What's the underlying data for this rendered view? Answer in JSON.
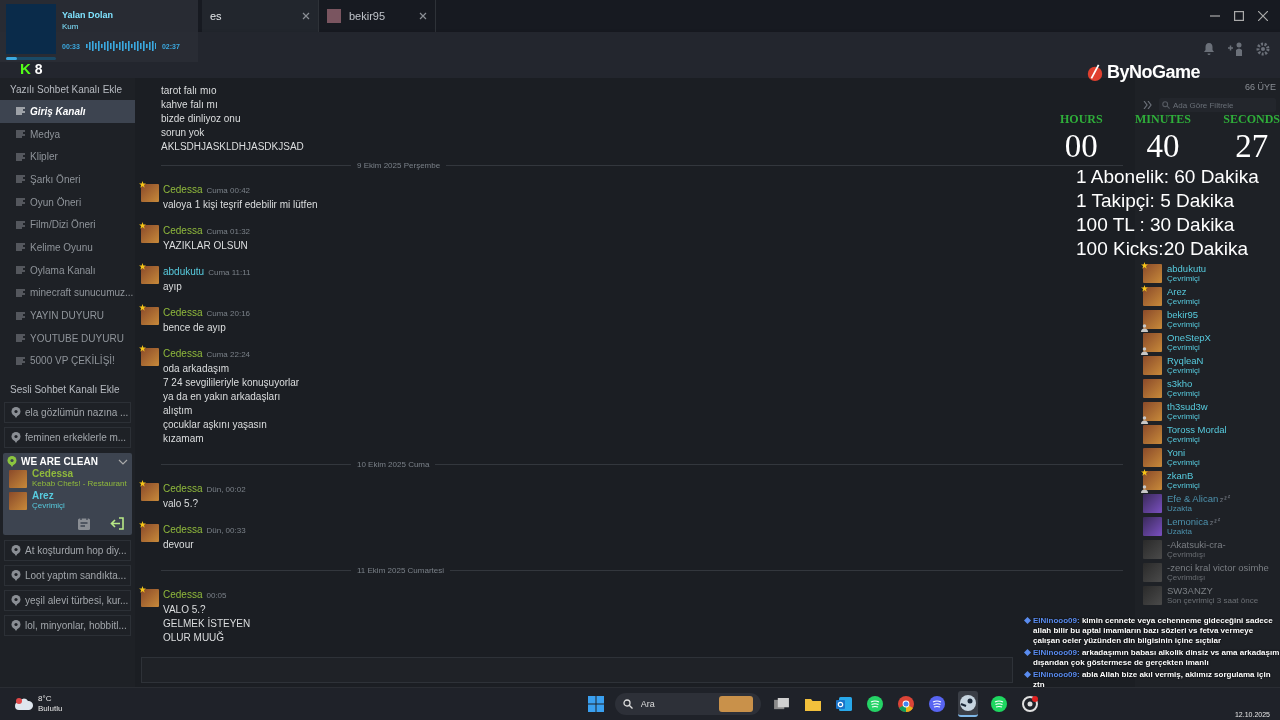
{
  "music_widget": {
    "title": "Yalan Dolan",
    "artist": "Kum",
    "elapsed": "00:33",
    "duration": "02:37",
    "level": 0.21
  },
  "tabs": [
    {
      "label": "es",
      "selected": true
    },
    {
      "label": "bekir95",
      "selected": false
    }
  ],
  "kick_badge": {
    "logo": "K",
    "count": "8"
  },
  "logo": "ByNoGame",
  "member_count": "66 ÜYE",
  "filter": {
    "placeholder": "Ada Göre Filtrele"
  },
  "sidebar": {
    "text_heading": "Yazılı Sohbet Kanalı Ekle",
    "text_channels": [
      {
        "name": "Giriş Kanalı",
        "selected": true
      },
      {
        "name": "Medya",
        "selected": false
      },
      {
        "name": "Klipler",
        "selected": false
      },
      {
        "name": "Şarkı Öneri",
        "selected": false
      },
      {
        "name": "Oyun Öneri",
        "selected": false
      },
      {
        "name": "Film/Dizi Öneri",
        "selected": false
      },
      {
        "name": "Kelime Oyunu",
        "selected": false
      },
      {
        "name": "Oylama Kanalı",
        "selected": false
      },
      {
        "name": "minecraft sunucumuz...",
        "selected": false
      },
      {
        "name": "YAYIN DUYURU",
        "selected": false
      },
      {
        "name": "YOUTUBE DUYURU",
        "selected": false
      },
      {
        "name": "5000 VP ÇEKİLİŞİ!",
        "selected": false
      }
    ],
    "voice_heading": "Sesli Sohbet Kanalı Ekle",
    "voice_channels": [
      {
        "name": "ela gözlümün nazına ...",
        "active": false
      },
      {
        "name": "feminen erkeklerle m...",
        "active": false
      },
      {
        "name": "WE ARE CLEAN",
        "active": true,
        "members": [
          {
            "name": "Cedessa",
            "status": "Kebab Chefs! - Restaurant",
            "kind": "ingame"
          },
          {
            "name": "Arez",
            "status": "Çevrimiçi",
            "kind": "online"
          }
        ]
      },
      {
        "name": "At koşturdum hop diy...",
        "active": false
      },
      {
        "name": "Loot yaptım sandıkta...",
        "active": false
      },
      {
        "name": "yeşil alevi türbesi, kur...",
        "active": false
      },
      {
        "name": "lol, minyonlar, hobbitl...",
        "active": false
      }
    ]
  },
  "chat": [
    {
      "kind": "continuation",
      "lines": [
        "tarot falı mıo",
        "kahve falı mı",
        "bizde dinliyoz onu",
        "sorun yok",
        "AKLSDHJASKLDHJASDKJSAD"
      ]
    },
    {
      "kind": "divider",
      "label": "9 Ekim 2025 Perşembe"
    },
    {
      "kind": "message",
      "author": {
        "name": "Cedessa",
        "kind": "ingame"
      },
      "time": "Cuma 00:42",
      "lines": [
        "valoya 1 kişi teşrif edebilir mi lütfen"
      ]
    },
    {
      "kind": "message",
      "author": {
        "name": "Cedessa",
        "kind": "ingame"
      },
      "time": "Cuma 01:32",
      "lines": [
        "YAZIKLAR OLSUN"
      ]
    },
    {
      "kind": "message",
      "author": {
        "name": "abdukutu",
        "kind": "online"
      },
      "time": "Cuma 11:11",
      "lines": [
        "ayıp"
      ]
    },
    {
      "kind": "message",
      "author": {
        "name": "Cedessa",
        "kind": "ingame"
      },
      "time": "Cuma 20:16",
      "lines": [
        "bence de ayıp"
      ]
    },
    {
      "kind": "message",
      "author": {
        "name": "Cedessa",
        "kind": "ingame"
      },
      "time": "Cuma 22:24",
      "lines": [
        "oda arkadaşım",
        "7 24 sevgilileriyle konuşuyorlar",
        "ya da en yakın arkadaşları",
        "alıştım",
        "çocuklar aşkını yaşasın",
        "kızamam"
      ]
    },
    {
      "kind": "divider",
      "label": "10 Ekim 2025 Cuma"
    },
    {
      "kind": "message",
      "author": {
        "name": "Cedessa",
        "kind": "ingame"
      },
      "time": "Dün, 00:02",
      "lines": [
        "valo 5.?"
      ]
    },
    {
      "kind": "message",
      "author": {
        "name": "Cedessa",
        "kind": "ingame"
      },
      "time": "Dün, 00:33",
      "lines": [
        "devour"
      ]
    },
    {
      "kind": "divider",
      "label": "11 Ekim 2025 Cumartesi"
    },
    {
      "kind": "message",
      "author": {
        "name": "Cedessa",
        "kind": "ingame"
      },
      "time": "00:05",
      "lines": [
        "VALO 5.?",
        "GELMEK İSTEYEN",
        "OLUR MUUĞ"
      ]
    }
  ],
  "members": [
    {
      "name": "abdukutu",
      "status": "Çevrimiçi",
      "kind": "online",
      "starred": true,
      "friend": false
    },
    {
      "name": "Arez",
      "status": "Çevrimiçi",
      "kind": "online",
      "starred": true,
      "friend": false
    },
    {
      "name": "bekir95",
      "status": "Çevrimiçi",
      "kind": "online",
      "starred": false,
      "friend": true
    },
    {
      "name": "OneStepX",
      "status": "Çevrimiçi",
      "kind": "online",
      "starred": false,
      "friend": true
    },
    {
      "name": "RyqleaN",
      "status": "Çevrimiçi",
      "kind": "online",
      "starred": false,
      "friend": false
    },
    {
      "name": "s3kho",
      "status": "Çevrimiçi",
      "kind": "online",
      "starred": false,
      "friend": false
    },
    {
      "name": "th3sud3w",
      "status": "Çevrimiçi",
      "kind": "online",
      "starred": false,
      "friend": true
    },
    {
      "name": "Toross Mordal",
      "status": "Çevrimiçi",
      "kind": "online",
      "starred": false,
      "friend": false
    },
    {
      "name": "Yoni",
      "status": "Çevrimiçi",
      "kind": "online",
      "starred": false,
      "friend": false
    },
    {
      "name": "zkanB",
      "status": "Çevrimiçi",
      "kind": "online",
      "starred": true,
      "friend": true
    },
    {
      "name": "Efe & Alican",
      "status": "Uzakta",
      "kind": "away",
      "starred": false,
      "friend": false
    },
    {
      "name": "Lemonica",
      "status": "Uzakta",
      "kind": "away",
      "starred": false,
      "friend": false
    },
    {
      "name": "-Akatsuki-cra-",
      "status": "Çevrimdışı",
      "kind": "offline",
      "starred": false,
      "friend": false
    },
    {
      "name": "-zenci kral victor osimhe",
      "status": "Çevrimdışı",
      "kind": "offline",
      "starred": false,
      "friend": false
    },
    {
      "name": "SW3ANZY",
      "status": "Son çevrimiçi 3 saat önce",
      "kind": "offline",
      "starred": false,
      "friend": false
    }
  ],
  "timer": {
    "units": [
      {
        "label": "HOURS",
        "value": "00"
      },
      {
        "label": "MINUTES",
        "value": "40"
      },
      {
        "label": "SECONDS",
        "value": "27"
      }
    ],
    "rules": [
      "1 Abonelik: 60 Dakika",
      "1 Takipçi: 5 Dakika",
      "100 TL : 30 Dakika",
      "100 Kicks:20 Dakika"
    ]
  },
  "stream_chat": [
    {
      "user": "ElNinooo09:",
      "text": "kimin cennete veya cehenneme gideceğini sadece allah bilir bu aptal imamların bazı sözleri vs fetva vermeye çalışan oeler yüzünden din bilgisinin içine sıçtılar"
    },
    {
      "user": "ElNinooo09:",
      "text": "arkadaşımın babası alkolik dinsiz vs ama arkadaşım dışarıdan çok göstermese de gerçekten imanlı"
    },
    {
      "user": "ElNinooo09:",
      "text": "abla Allah bize akıl vermiş, aklımız sorgulama için ztn"
    }
  ],
  "taskbar": {
    "weather": {
      "temp": "8°C",
      "condition": "Bulutlu"
    },
    "search_placeholder": "Ara",
    "apps": [
      {
        "kind": "taskview",
        "active": false
      },
      {
        "kind": "folder",
        "active": false
      },
      {
        "kind": "mail",
        "active": false
      },
      {
        "kind": "whatsapp",
        "active": false
      },
      {
        "kind": "chrome",
        "active": false
      },
      {
        "kind": "discord",
        "active": false
      },
      {
        "kind": "steam",
        "active": true
      },
      {
        "kind": "spotify",
        "active": false
      },
      {
        "kind": "record",
        "active": false
      }
    ],
    "date": "12.10.2025"
  }
}
